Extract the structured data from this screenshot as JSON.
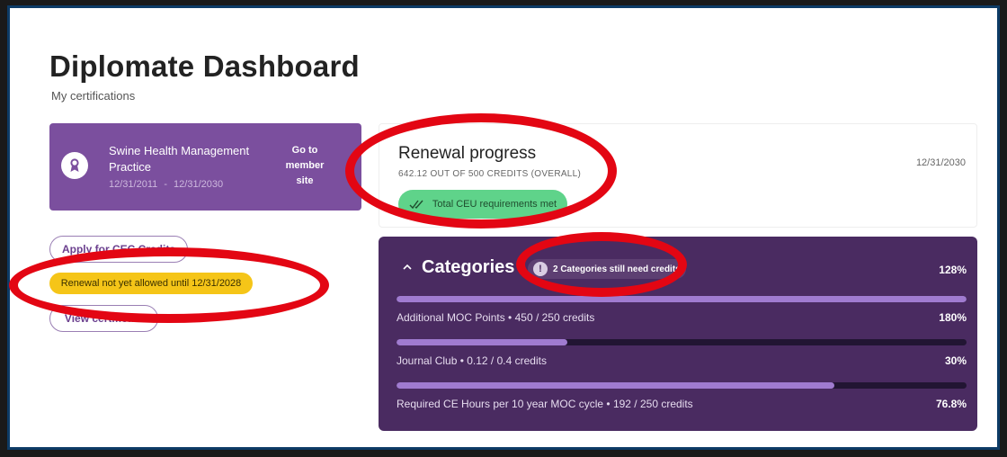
{
  "header": {
    "title": "Diplomate Dashboard",
    "subtitle": "My certifications"
  },
  "certification": {
    "icon": "award-ribbon-icon",
    "name": "Swine Health Management Practice",
    "start_date": "12/31/2011",
    "separator": "-",
    "end_date": "12/31/2030",
    "link_label": "Go to member site"
  },
  "actions": {
    "apply_cec_label": "Apply for CEC Credits",
    "renewal_notice": "Renewal not yet allowed until 12/31/2028",
    "certificate_label": "View certificate"
  },
  "renewal": {
    "title": "Renewal progress",
    "credits_text": "642.12 OUT OF 500 CREDITS (OVERALL)",
    "date": "12/31/2030",
    "status_label": "Total CEU requirements met",
    "status_color": "#5fd38a"
  },
  "categories": {
    "title": "Categories",
    "alert_label": "2 Categories still need credits",
    "total_percent": "128%",
    "items": [
      {
        "label": "Additional MOC Points • 450 / 250 credits",
        "percent": "180%",
        "fill": 1.0
      },
      {
        "label": "Journal Club • 0.12 / 0.4 credits",
        "percent": "30%",
        "fill": 0.3
      },
      {
        "label": "Required CE Hours per 10 year MOC cycle • 192 / 250 credits",
        "percent": "76.8%",
        "fill": 0.768
      }
    ]
  },
  "colors": {
    "brand_purple": "#7b4f9e",
    "panel_purple": "#4a2b61",
    "bar_fill": "#a07bd0",
    "warning_yellow": "#f5c518",
    "annotation_red": "#e30613"
  }
}
